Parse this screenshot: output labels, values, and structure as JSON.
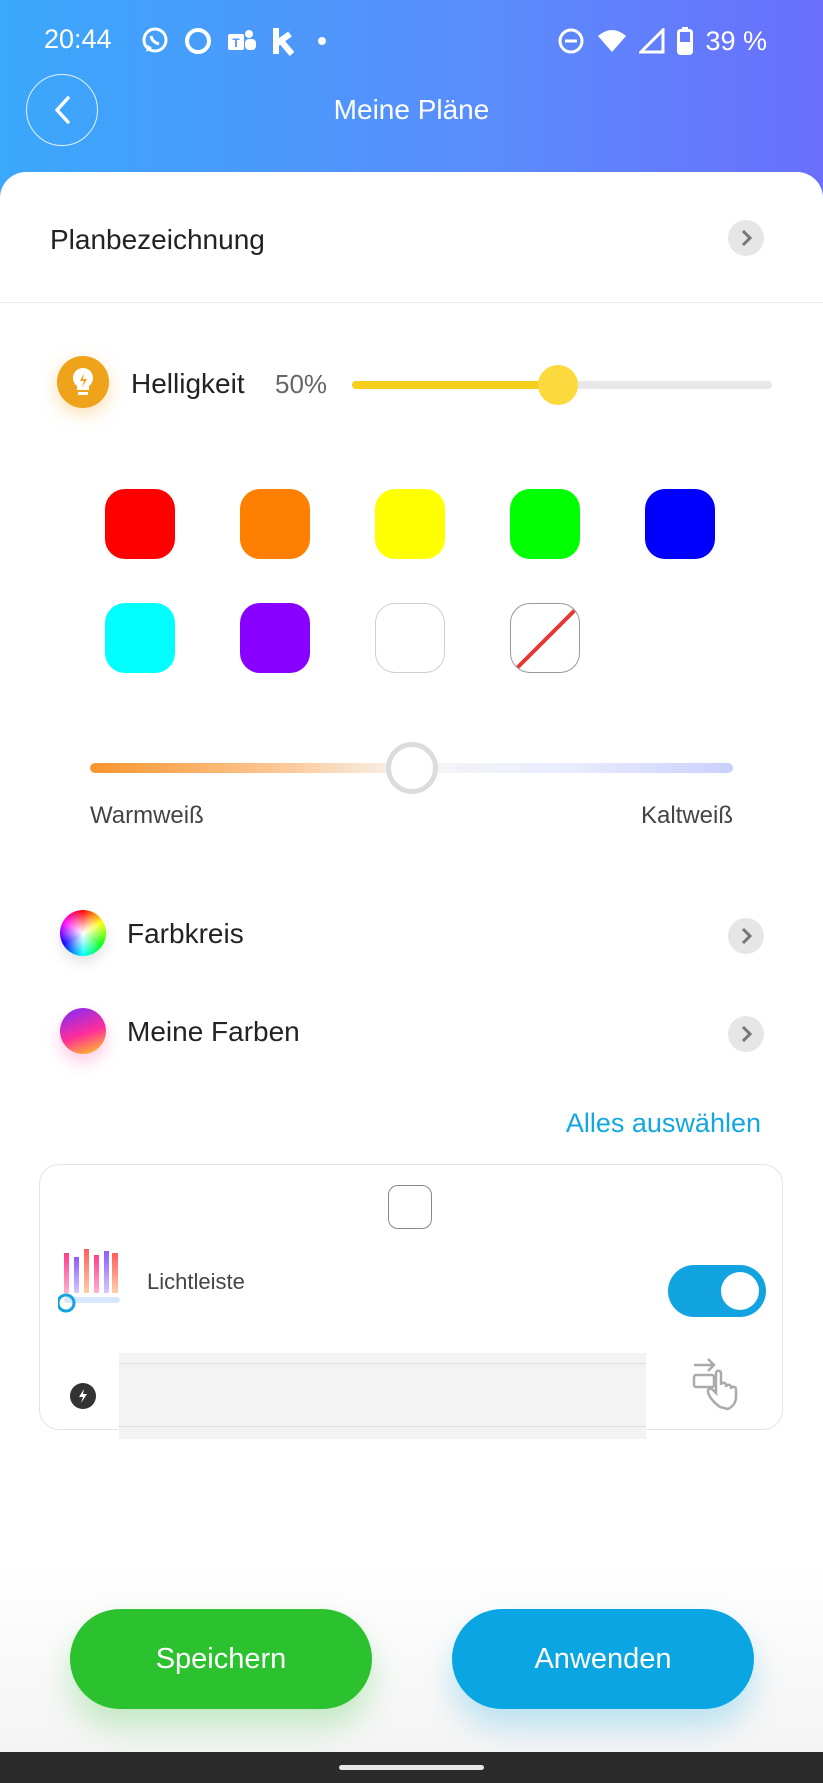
{
  "status_bar": {
    "time": "20:44",
    "left_icons": [
      "whatsapp-icon",
      "circle-app-icon",
      "teams-icon",
      "k-app-icon",
      "dot-icon"
    ],
    "right_icons": [
      "do-not-disturb-icon",
      "wifi-icon",
      "signal-icon",
      "battery-icon"
    ],
    "battery": "39 %"
  },
  "header": {
    "title": "Meine Pläne",
    "back_icon": "back-arrow-icon"
  },
  "plan_name": {
    "label": "Planbezeichnung"
  },
  "brightness": {
    "label": "Helligkeit",
    "value_text": "50%",
    "value": 0.5,
    "fill_color": "#f5cf1b"
  },
  "swatches": [
    {
      "name": "red",
      "color": "#ff0000"
    },
    {
      "name": "orange",
      "color": "#ff7f00"
    },
    {
      "name": "yellow",
      "color": "#ffff00"
    },
    {
      "name": "green",
      "color": "#00ff00"
    },
    {
      "name": "blue",
      "color": "#0000ff"
    },
    {
      "name": "cyan",
      "color": "#00ffff"
    },
    {
      "name": "purple",
      "color": "#8800ff"
    },
    {
      "name": "white",
      "color": "#ffffff"
    },
    {
      "name": "none",
      "color": "none"
    }
  ],
  "color_temperature": {
    "left_label": "Warmweiß",
    "right_label": "Kaltweiß",
    "value": 0.5
  },
  "options": [
    {
      "label": "Farbkreis",
      "icon": "color-wheel-icon"
    },
    {
      "label": "Meine Farben",
      "icon": "my-colors-icon"
    }
  ],
  "select_all": "Alles auswählen",
  "device": {
    "name": "Lichtleiste",
    "checked": false,
    "power_on": true
  },
  "buttons": {
    "save": "Speichern",
    "apply": "Anwenden"
  },
  "colors": {
    "accent": "#12a4e0",
    "save": "#2cc22f",
    "header_start": "#3aa8fb",
    "header_end": "#6a6ffd"
  }
}
